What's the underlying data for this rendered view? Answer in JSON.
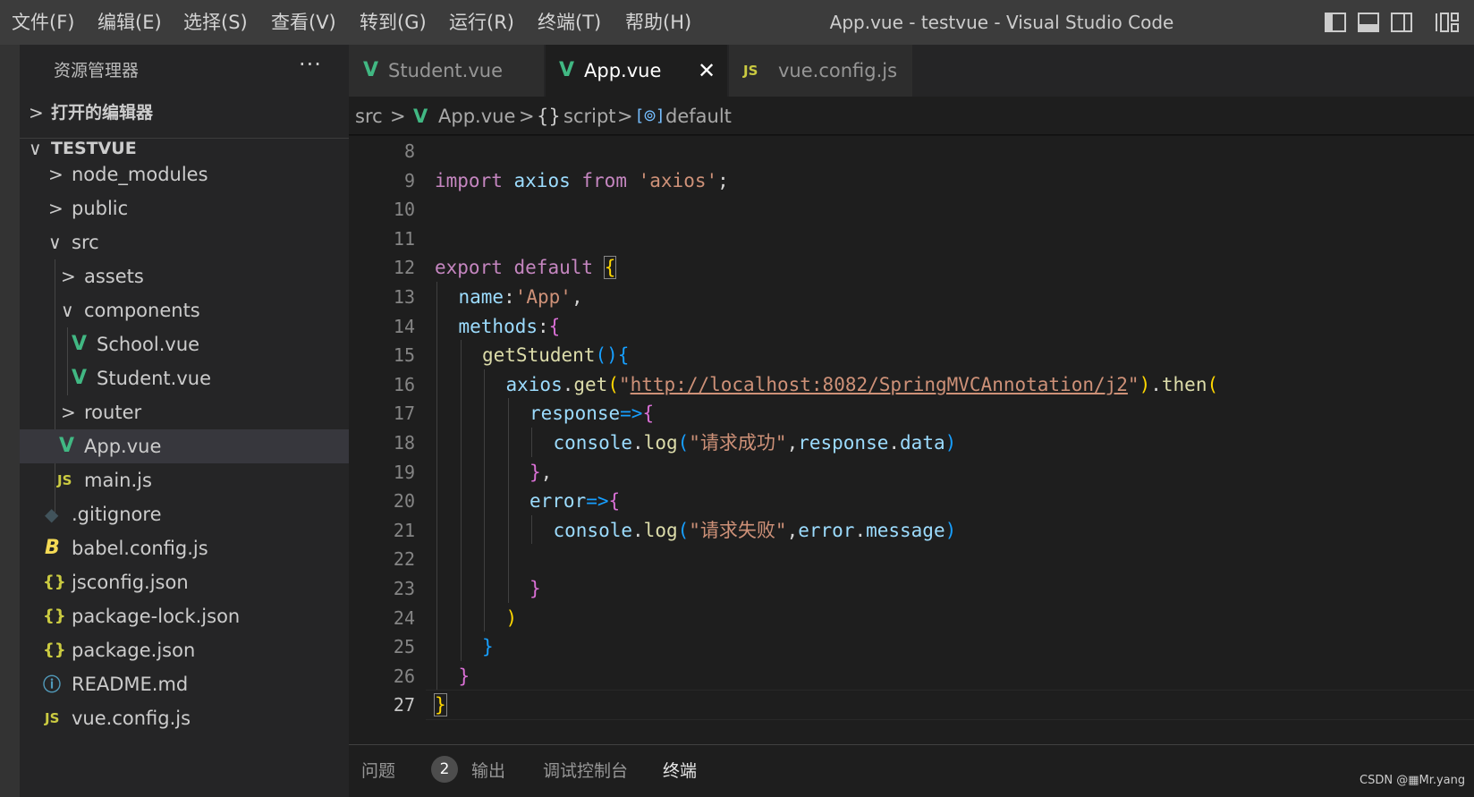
{
  "window": {
    "title": "App.vue - testvue - Visual Studio Code"
  },
  "menu": [
    "文件(F)",
    "编辑(E)",
    "选择(S)",
    "查看(V)",
    "转到(G)",
    "运行(R)",
    "终端(T)",
    "帮助(H)"
  ],
  "sidebar": {
    "header": "资源管理器",
    "more": "···",
    "open_editors": "打开的编辑器",
    "project": "TESTVUE",
    "tree": [
      {
        "label": "node_modules",
        "kind": "folder",
        "expanded": false
      },
      {
        "label": "public",
        "kind": "folder",
        "expanded": false
      },
      {
        "label": "src",
        "kind": "folder",
        "expanded": true
      },
      {
        "label": "assets",
        "kind": "folder",
        "expanded": false
      },
      {
        "label": "components",
        "kind": "folder",
        "expanded": true
      },
      {
        "label": "School.vue",
        "kind": "vue"
      },
      {
        "label": "Student.vue",
        "kind": "vue"
      },
      {
        "label": "router",
        "kind": "folder",
        "expanded": false
      },
      {
        "label": "App.vue",
        "kind": "vue",
        "selected": true
      },
      {
        "label": "main.js",
        "kind": "js"
      },
      {
        "label": ".gitignore",
        "kind": "git"
      },
      {
        "label": "babel.config.js",
        "kind": "babel"
      },
      {
        "label": "jsconfig.json",
        "kind": "json"
      },
      {
        "label": "package-lock.json",
        "kind": "json"
      },
      {
        "label": "package.json",
        "kind": "json"
      },
      {
        "label": "README.md",
        "kind": "info"
      },
      {
        "label": "vue.config.js",
        "kind": "js"
      }
    ]
  },
  "tabs": [
    {
      "label": "Student.vue",
      "icon": "V",
      "active": false
    },
    {
      "label": "App.vue",
      "icon": "V",
      "active": true,
      "close": "✕"
    },
    {
      "label": "vue.config.js",
      "icon": "JS",
      "active": false
    }
  ],
  "breadcrumb": {
    "folder": "src",
    "file": "App.vue",
    "section": "script",
    "symbol": "default"
  },
  "editor": {
    "current_line": 27,
    "lines": [
      {
        "n": 8,
        "indent": 0,
        "tokens": []
      },
      {
        "n": 9,
        "indent": 0,
        "tokens": [
          [
            "import",
            "kw"
          ],
          [
            " "
          ],
          [
            "axios",
            "var"
          ],
          [
            " "
          ],
          [
            "from",
            "kw"
          ],
          [
            " "
          ],
          [
            "'axios'",
            "str"
          ],
          [
            ";"
          ]
        ]
      },
      {
        "n": 10,
        "indent": 0,
        "tokens": []
      },
      {
        "n": 11,
        "indent": 0,
        "tokens": []
      },
      {
        "n": 12,
        "indent": 0,
        "tokens": [
          [
            "export",
            "kw"
          ],
          [
            " "
          ],
          [
            "default",
            "kw"
          ],
          [
            " "
          ],
          [
            "{",
            "p1 bm"
          ]
        ]
      },
      {
        "n": 13,
        "indent": 1,
        "tokens": [
          [
            "name",
            "var"
          ],
          [
            ":"
          ],
          [
            "'App'",
            "str"
          ],
          [
            ","
          ]
        ]
      },
      {
        "n": 14,
        "indent": 1,
        "tokens": [
          [
            "methods",
            "var"
          ],
          [
            ":"
          ],
          [
            "{",
            "p2"
          ]
        ]
      },
      {
        "n": 15,
        "indent": 2,
        "tokens": [
          [
            "getStudent",
            "fn"
          ],
          [
            "()",
            "p3"
          ],
          [
            "{",
            "p3"
          ]
        ]
      },
      {
        "n": 16,
        "indent": 3,
        "tokens": [
          [
            "axios",
            "var"
          ],
          [
            "."
          ],
          [
            "get",
            "fn"
          ],
          [
            "(",
            "p1"
          ],
          [
            "\"",
            "str"
          ],
          [
            "http://localhost:8082/SpringMVCAnnotation/j2",
            "url"
          ],
          [
            "\"",
            "str"
          ],
          [
            ")",
            "p1"
          ],
          [
            "."
          ],
          [
            "then",
            "fn"
          ],
          [
            "(",
            "p1"
          ]
        ]
      },
      {
        "n": 17,
        "indent": 4,
        "tokens": [
          [
            "response",
            "var"
          ],
          [
            "=>",
            "p3"
          ],
          [
            "{",
            "p2"
          ]
        ]
      },
      {
        "n": 18,
        "indent": 5,
        "tokens": [
          [
            "console",
            "var"
          ],
          [
            "."
          ],
          [
            "log",
            "fn"
          ],
          [
            "(",
            "p3"
          ],
          [
            "\"请求成功\"",
            "str"
          ],
          [
            ","
          ],
          [
            "response",
            "var"
          ],
          [
            "."
          ],
          [
            "data",
            "var"
          ],
          [
            ")",
            "p3"
          ]
        ]
      },
      {
        "n": 19,
        "indent": 4,
        "tokens": [
          [
            "}",
            "p2"
          ],
          [
            ","
          ]
        ]
      },
      {
        "n": 20,
        "indent": 4,
        "tokens": [
          [
            "error",
            "var"
          ],
          [
            "=>",
            "p3"
          ],
          [
            "{",
            "p2"
          ]
        ]
      },
      {
        "n": 21,
        "indent": 5,
        "tokens": [
          [
            "console",
            "var"
          ],
          [
            "."
          ],
          [
            "log",
            "fn"
          ],
          [
            "(",
            "p3"
          ],
          [
            "\"请求失败\"",
            "str"
          ],
          [
            ","
          ],
          [
            "error",
            "var"
          ],
          [
            "."
          ],
          [
            "message",
            "var"
          ],
          [
            ")",
            "p3"
          ]
        ]
      },
      {
        "n": 22,
        "indent": 0,
        "tokens": []
      },
      {
        "n": 23,
        "indent": 4,
        "tokens": [
          [
            "}",
            "p2"
          ]
        ]
      },
      {
        "n": 24,
        "indent": 3,
        "tokens": [
          [
            ")",
            "p1"
          ]
        ]
      },
      {
        "n": 25,
        "indent": 2,
        "tokens": [
          [
            "}",
            "p3"
          ]
        ]
      },
      {
        "n": 26,
        "indent": 1,
        "tokens": [
          [
            "}",
            "p2"
          ]
        ]
      },
      {
        "n": 27,
        "indent": 0,
        "tokens": [
          [
            "}",
            "p1 bm"
          ]
        ]
      }
    ]
  },
  "panel": {
    "tabs": [
      {
        "label": "问题",
        "active": false
      },
      {
        "label": "输出",
        "active": false
      },
      {
        "label": "调试控制台",
        "active": false
      },
      {
        "label": "终端",
        "active": true
      }
    ],
    "problems_count": "2"
  },
  "watermark": "CSDN @▦Mr.yang"
}
